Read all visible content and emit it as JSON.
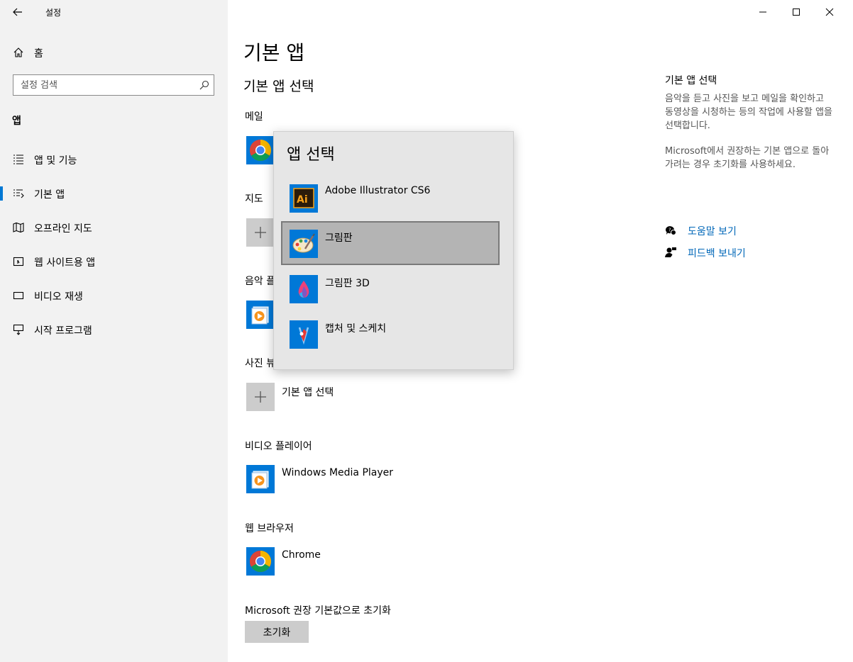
{
  "window": {
    "title": "설정"
  },
  "sidebar": {
    "home_label": "홈",
    "search_placeholder": "설정 검색",
    "section_title": "앱",
    "items": [
      {
        "label": "앱 및 기능",
        "icon": "list-icon"
      },
      {
        "label": "기본 앱",
        "icon": "default-apps-icon",
        "active": true
      },
      {
        "label": "오프라인 지도",
        "icon": "map-icon"
      },
      {
        "label": "웹 사이트용 앱",
        "icon": "website-apps-icon"
      },
      {
        "label": "비디오 재생",
        "icon": "video-icon"
      },
      {
        "label": "시작 프로그램",
        "icon": "startup-icon"
      }
    ]
  },
  "main": {
    "page_title": "기본 앱",
    "subtitle": "기본 앱 선택",
    "categories": [
      {
        "label": "메일",
        "app": ""
      },
      {
        "label": "지도",
        "app": ""
      },
      {
        "label": "음악 플",
        "app": ""
      },
      {
        "label": "사진 뷰",
        "app": "기본 앱 선택"
      },
      {
        "label": "비디오 플레이어",
        "app": "Windows Media Player"
      },
      {
        "label": "웹 브라우저",
        "app": "Chrome"
      }
    ],
    "reset_label": "Microsoft 권장 기본값으로 초기화",
    "reset_button": "초기화"
  },
  "right_panel": {
    "title": "기본 앱 선택",
    "text1": "음악을 듣고 사진을 보고 메일을 확인하고 동영상을 시청하는 등의 작업에 사용할 앱을 선택합니다.",
    "text2": "Microsoft에서 권장하는 기본 앱으로 돌아가려는 경우 초기화를 사용하세요.",
    "help_link": "도움말 보기",
    "feedback_link": "피드백 보내기"
  },
  "flyout": {
    "title": "앱 선택",
    "items": [
      {
        "name": "Adobe Illustrator CS6",
        "icon": "illustrator-icon"
      },
      {
        "name": "그림판",
        "icon": "paint-icon",
        "selected": true
      },
      {
        "name": "그림판 3D",
        "icon": "paint-3d-icon"
      },
      {
        "name": "캡처 및 스케치",
        "icon": "snip-sketch-icon"
      }
    ]
  },
  "colors": {
    "accent": "#0078d4",
    "link": "#0067b8",
    "tile": "#0078d7"
  }
}
